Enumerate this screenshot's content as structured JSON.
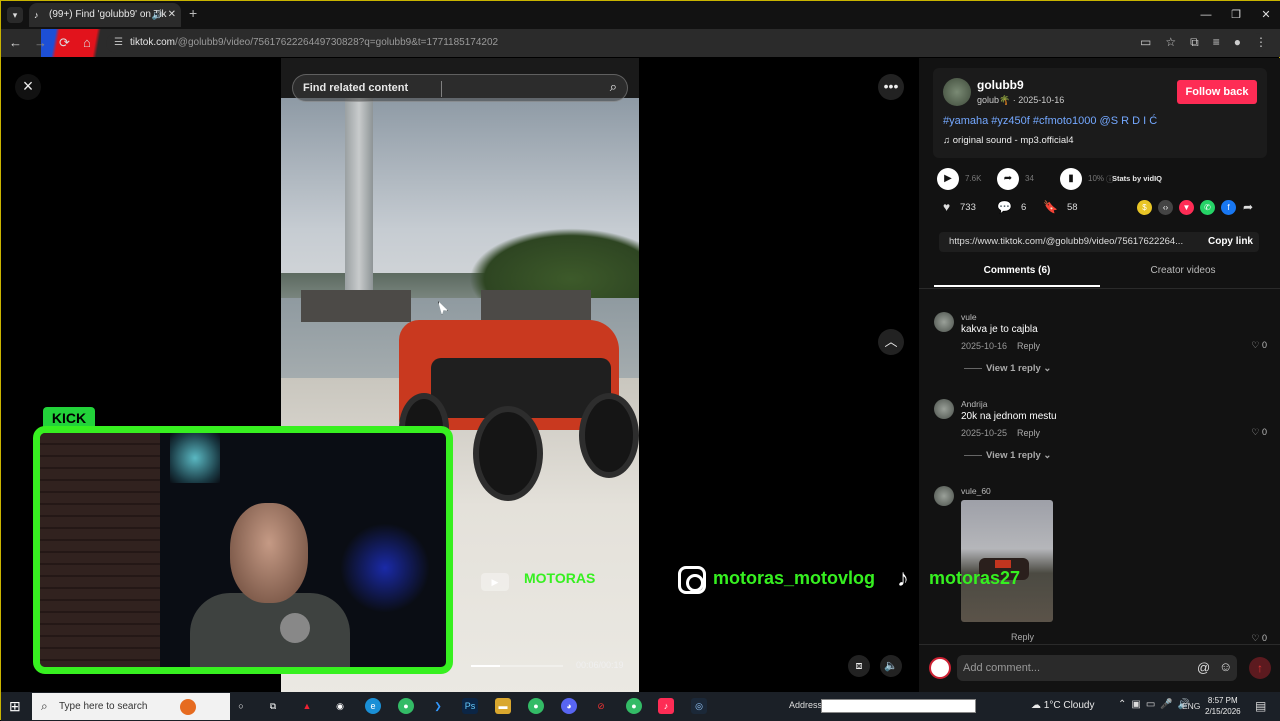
{
  "browser": {
    "tab_title": "(99+) Find 'golubb9' on Tik",
    "url_host": "tiktok.com",
    "url_path": "/@golubb9/video/7561762226449730828?q=golubb9&t=1771185174202",
    "new_tab": "+",
    "win_min": "—",
    "win_max": "❐",
    "win_close": "✕"
  },
  "player": {
    "search_placeholder": "Find related content",
    "time": "00:06/00:19",
    "progress": 0.3158
  },
  "overlay": {
    "kick_label": "KICK",
    "brand_small": "MOTORAS",
    "instagram": "motoras_motovlog",
    "tiktok": "motoras27"
  },
  "post": {
    "username": "golubb9",
    "subline": "golub🌴 · 2025-10-16",
    "follow_label": "Follow back",
    "hashtags": "#yamaha #yz450f #cfmoto1000 @S R D I Ć",
    "sound": "original sound - mp3.official4",
    "plays": "7.6K",
    "shares_stat": "34",
    "percent": "10%",
    "stats_by": "Stats by vidIQ",
    "likes": "733",
    "comments": "6",
    "saves": "58",
    "link": "https://www.tiktok.com/@golubb9/video/75617622264...",
    "copy_label": "Copy link"
  },
  "tabs": {
    "comments": "Comments (6)",
    "creator": "Creator videos"
  },
  "comments": [
    {
      "user": "vule",
      "text": "kakva je to cajbla",
      "date": "2025-10-16",
      "reply": "Reply",
      "likes": "0",
      "view": "View 1 reply"
    },
    {
      "user": "Andrija",
      "text": "20k na jednom mestu",
      "date": "2025-10-25",
      "reply": "Reply",
      "likes": "0",
      "view": "View 1 reply"
    },
    {
      "user": "vule_60",
      "text": "",
      "reply": "Reply",
      "likes": "0"
    }
  ],
  "composer": {
    "placeholder": "Add comment..."
  },
  "taskbar": {
    "search": "Type here to search",
    "address": "Address",
    "weather": "1°C  Cloudy",
    "lang": "ENG",
    "time": "8:57 PM",
    "date": "2/15/2026"
  }
}
